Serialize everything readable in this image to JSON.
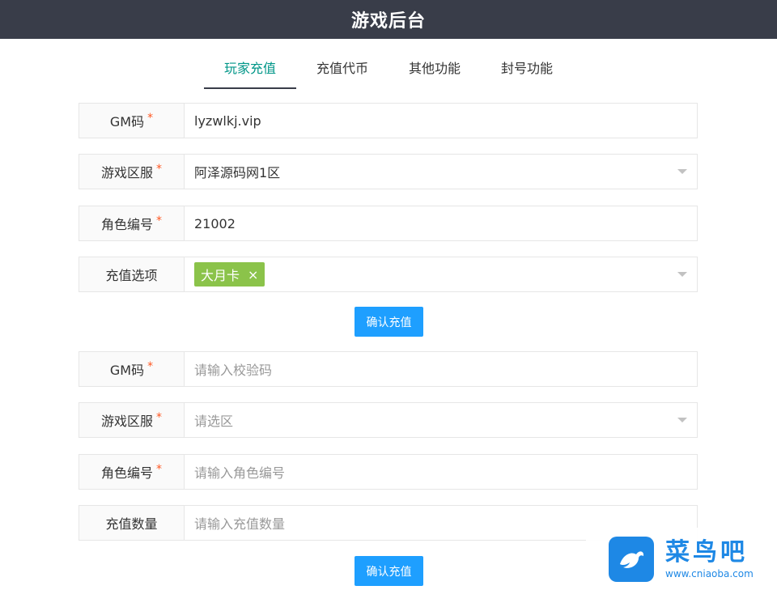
{
  "app": {
    "title": "游戏后台"
  },
  "tabs": [
    {
      "label": "玩家充值",
      "active": true
    },
    {
      "label": "充值代币",
      "active": false
    },
    {
      "label": "其他功能",
      "active": false
    },
    {
      "label": "封号功能",
      "active": false
    }
  ],
  "form1": {
    "gm": {
      "label": "GM码",
      "value": "lyzwlkj.vip"
    },
    "server": {
      "label": "游戏区服",
      "value": "阿泽源码网1区"
    },
    "role": {
      "label": "角色编号",
      "value": "21002"
    },
    "option": {
      "label": "充值选项",
      "tag": "大月卡",
      "tag_close": "×"
    },
    "submit": "确认充值"
  },
  "form2": {
    "gm": {
      "label": "GM码",
      "placeholder": "请输入校验码"
    },
    "server": {
      "label": "游戏区服",
      "placeholder": "请选区"
    },
    "role": {
      "label": "角色编号",
      "placeholder": "请输入角色编号"
    },
    "amount": {
      "label": "充值数量",
      "placeholder": "请输入充值数量"
    },
    "submit": "确认充值"
  },
  "required_mark": "*",
  "watermark": {
    "title": "菜鸟吧",
    "url": "www.cniaoba.com"
  },
  "colors": {
    "topbar": "#393d49",
    "accent": "#009688",
    "button": "#1e9fff",
    "tag": "#8bc34a",
    "required": "#ff5722"
  }
}
